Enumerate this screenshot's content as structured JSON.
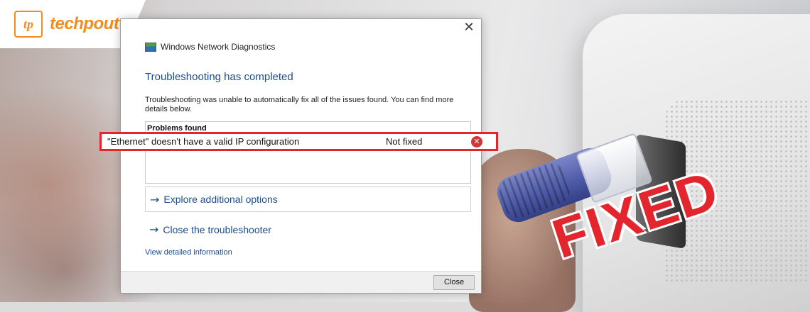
{
  "logo": {
    "mark": "tp",
    "text": "techpout"
  },
  "dialog": {
    "close_icon": "close-icon",
    "window_title": "Windows Network Diagnostics",
    "heading": "Troubleshooting has completed",
    "description": "Troubleshooting was unable to automatically fix all of the issues found. You can find more details below.",
    "problems_header": "Problems found",
    "problem": {
      "text": "\"Ethernet\" doesn't have a valid IP configuration",
      "status": "Not fixed",
      "status_icon": "error-icon"
    },
    "explore_link": "Explore additional options",
    "close_troubleshooter_link": "Close the troubleshooter",
    "detail_link": "View detailed information",
    "close_button": "Close"
  },
  "overlay": {
    "fixed_text": "FIXED"
  },
  "colors": {
    "accent_red": "#e3262d",
    "link_blue": "#1a4d8c",
    "logo_orange": "#f28c1c"
  }
}
